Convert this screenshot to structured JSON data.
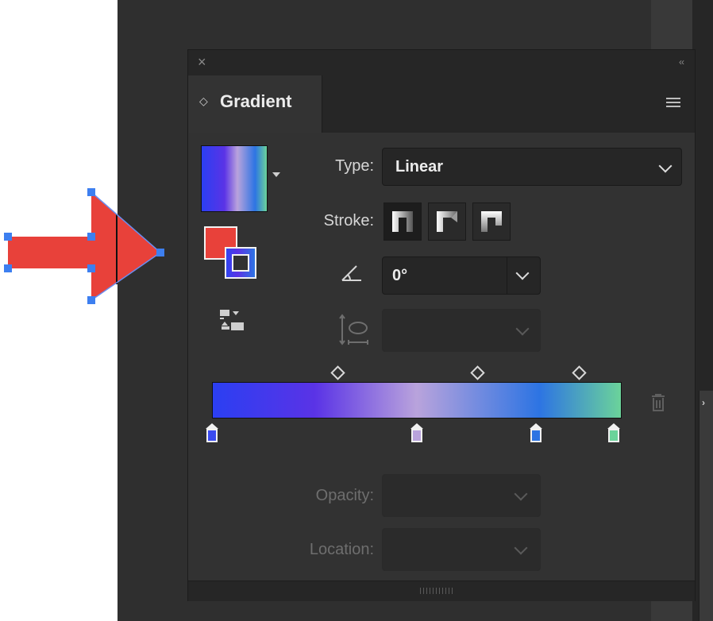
{
  "panel": {
    "close_glyph": "×",
    "collapse_glyph": "‹‹",
    "tab_title": "Gradient",
    "tab_updown_glyph": "◇"
  },
  "controls": {
    "type_label": "Type:",
    "type_value": "Linear",
    "stroke_label": "Stroke:",
    "angle_value": "0°",
    "opacity_label": "Opacity:",
    "location_label": "Location:"
  },
  "gradient": {
    "colors": [
      "#2b3ff2",
      "#5a33e6",
      "#b9a3dc",
      "#2d74e3",
      "#6bd39a"
    ],
    "stop_colors": [
      "#3a4bf0",
      "#b9a3dc",
      "#2d74e3",
      "#6bd39a"
    ]
  },
  "icons": {
    "close": "close-icon",
    "collapse": "collapse-panel-icon",
    "menu": "panel-menu-icon",
    "angle": "angle-icon",
    "aspect": "aspect-ratio-icon",
    "reverse": "reverse-gradient-icon",
    "trash": "trash-icon"
  },
  "artwork": {
    "fill_color": "#e8413a",
    "selection_color": "#3d7ff0"
  }
}
